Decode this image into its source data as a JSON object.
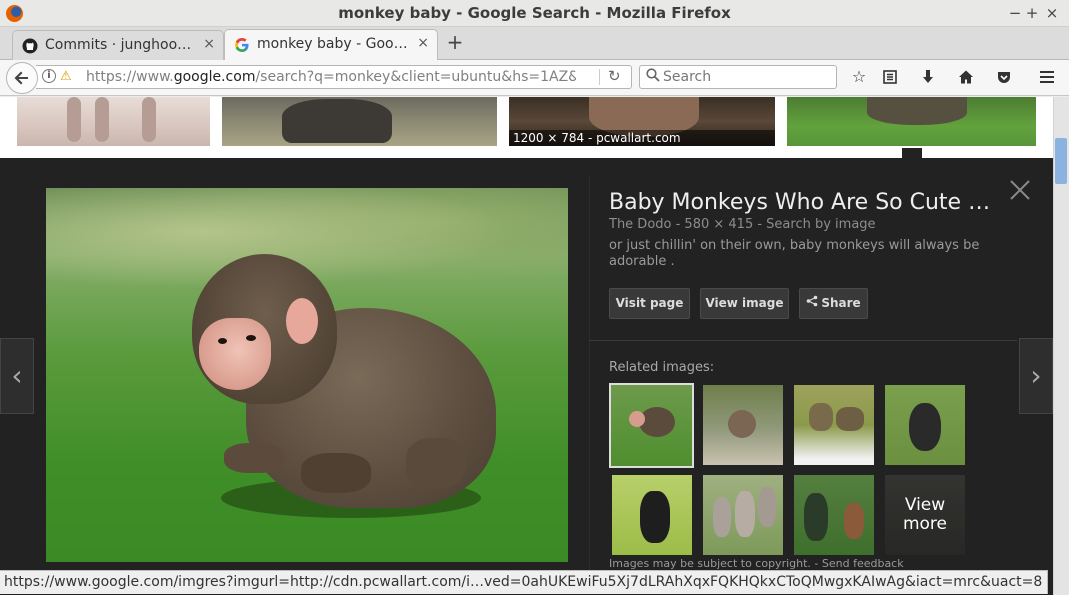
{
  "window": {
    "title": "monkey baby - Google Search - Mozilla Firefox"
  },
  "window_controls": {
    "minimize": "−",
    "maximize": "+",
    "close": "×"
  },
  "tabs": [
    {
      "label": "Commits · junghoo…",
      "icon": "github-icon",
      "close": "×"
    },
    {
      "label": "monkey baby - Goo…",
      "icon": "google-g-icon",
      "close": "×"
    }
  ],
  "newtab_label": "+",
  "nav": {
    "url_prefix": "https://www.",
    "url_domain": "google.com",
    "url_rest": "/search?q=monkey&client=ubuntu&hs=1AZ&c",
    "search_placeholder": "Search"
  },
  "thumbnails": [
    {
      "caption": ""
    },
    {
      "caption": ""
    },
    {
      "caption": "1200 × 784 - pcwallart.com"
    },
    {
      "caption": ""
    }
  ],
  "preview": {
    "title": "Baby Monkeys Who Are So Cute …",
    "meta": "The Dodo - 580 × 415 - Search by image",
    "description": "or just chillin' on their own, baby monkeys will always be adorable .",
    "buttons": {
      "visit": "Visit page",
      "view": "View image",
      "share": "Share"
    },
    "related_title": "Related images:",
    "view_more_line1": "View",
    "view_more_line2": "more",
    "footnote": "Images may be subject to copyright.  -  Send feedback"
  },
  "status_url": "https://www.google.com/imgres?imgurl=http://cdn.pcwallart.com/i…ved=0ahUKEwiFu5Xj7dLRAhXqxFQKHQkxCToQMwgxKAIwAg&iact=mrc&uact=8",
  "colors": {
    "panel_bg": "#222222",
    "scroll_thumb": "#8cb3e0",
    "text_light": "#eeeeee"
  }
}
